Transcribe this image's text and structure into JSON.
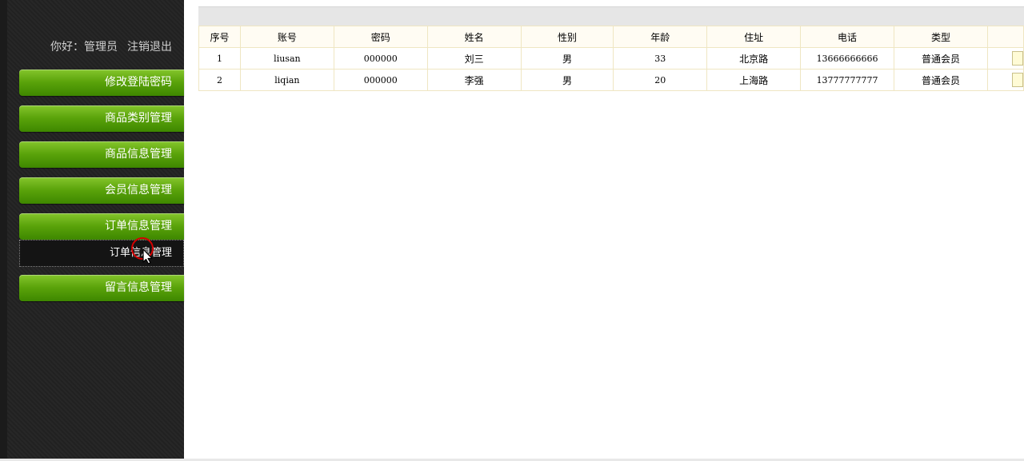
{
  "header": {
    "greeting": "你好：管理员",
    "logout_label": "注销退出"
  },
  "sidebar": {
    "items": [
      {
        "label": "修改登陆密码"
      },
      {
        "label": "商品类别管理"
      },
      {
        "label": "商品信息管理"
      },
      {
        "label": "会员信息管理"
      },
      {
        "label": "订单信息管理"
      },
      {
        "label": "留言信息管理"
      }
    ],
    "submenu": {
      "label": "订单信息管理"
    }
  },
  "table": {
    "columns": [
      "序号",
      "账号",
      "密码",
      "姓名",
      "性别",
      "年龄",
      "住址",
      "电话",
      "类型",
      ""
    ],
    "rows": [
      {
        "index": "1",
        "account": "liusan",
        "password": "000000",
        "name": "刘三",
        "gender": "男",
        "age": "33",
        "address": "北京路",
        "phone": "13666666666",
        "type": "普通会员"
      },
      {
        "index": "2",
        "account": "liqian",
        "password": "000000",
        "name": "李强",
        "gender": "男",
        "age": "20",
        "address": "上海路",
        "phone": "13777777777",
        "type": "普通会员"
      }
    ]
  },
  "icons": {
    "cursor": "mouse-pointer-icon"
  },
  "colors": {
    "sidebar_bg": "#232323",
    "menu_green": "#5aa30a",
    "table_border": "#efe6c2",
    "header_bar": "#e6e6e6",
    "click_circle": "#d40000"
  }
}
